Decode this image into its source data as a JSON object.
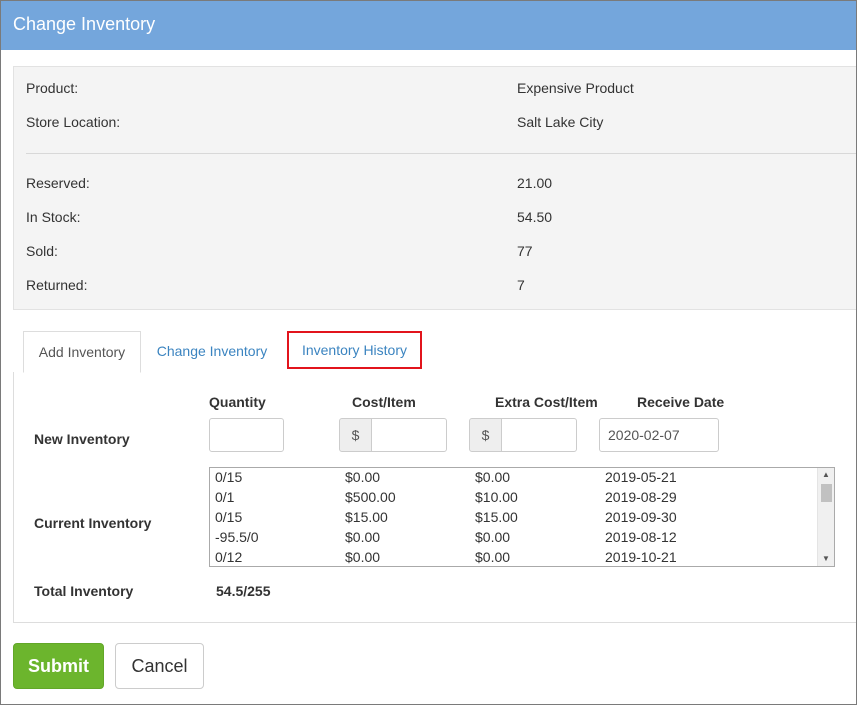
{
  "window": {
    "title": "Change Inventory"
  },
  "info": {
    "product_label": "Product:",
    "product_value": "Expensive Product",
    "location_label": "Store Location:",
    "location_value": "Salt Lake City",
    "reserved_label": "Reserved:",
    "reserved_value": "21.00",
    "instock_label": "In Stock:",
    "instock_value": "54.50",
    "sold_label": "Sold:",
    "sold_value": "77",
    "returned_label": "Returned:",
    "returned_value": "7"
  },
  "tabs": [
    {
      "label": "Add Inventory",
      "active": true
    },
    {
      "label": "Change Inventory",
      "active": false
    },
    {
      "label": "Inventory History",
      "active": false,
      "highlighted": true
    }
  ],
  "form": {
    "headers": {
      "quantity": "Quantity",
      "cost": "Cost/Item",
      "extra_cost": "Extra Cost/Item",
      "receive_date": "Receive Date"
    },
    "new_inventory_label": "New Inventory",
    "currency_symbol": "$",
    "quantity_value": "",
    "cost_value": "",
    "extra_cost_value": "",
    "receive_date_value": "2020-02-07",
    "current_inventory_label": "Current Inventory",
    "current_inventory_rows": [
      {
        "qty": "0/15",
        "cost": "$0.00",
        "extra": "$0.00",
        "date": "2019-05-21"
      },
      {
        "qty": "0/1",
        "cost": "$500.00",
        "extra": "$10.00",
        "date": "2019-08-29"
      },
      {
        "qty": "0/15",
        "cost": "$15.00",
        "extra": "$15.00",
        "date": "2019-09-30"
      },
      {
        "qty": "-95.5/0",
        "cost": "$0.00",
        "extra": "$0.00",
        "date": "2019-08-12"
      },
      {
        "qty": "0/12",
        "cost": "$0.00",
        "extra": "$0.00",
        "date": "2019-10-21"
      }
    ],
    "total_inventory_label": "Total Inventory",
    "total_inventory_value": "54.5/255"
  },
  "actions": {
    "submit_label": "Submit",
    "cancel_label": "Cancel"
  },
  "colors": {
    "title_bar": "#74a6dc",
    "submit": "#6cb52d",
    "highlight_border": "#e2141c",
    "link": "#3b84c0"
  }
}
